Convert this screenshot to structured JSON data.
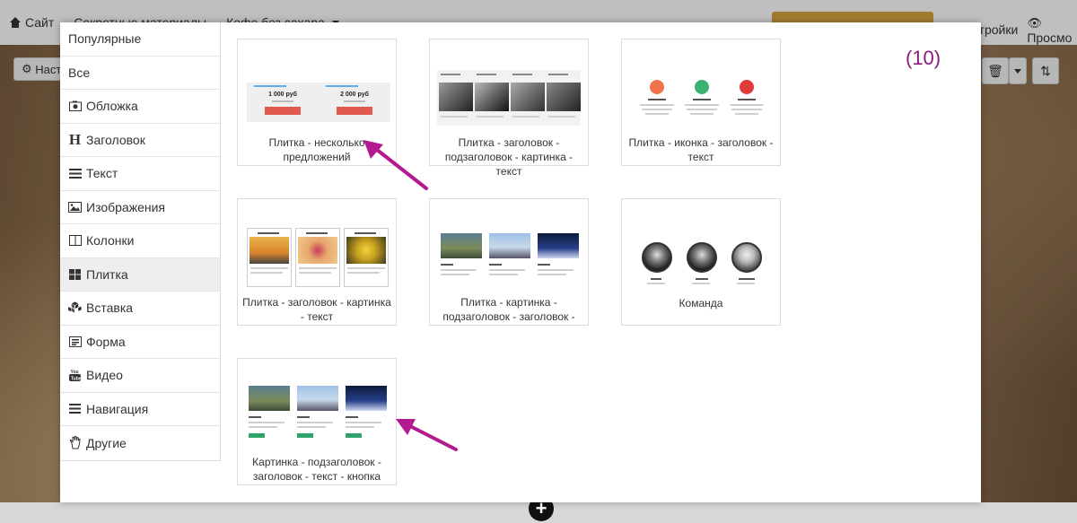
{
  "topbar": {
    "crumb_site": "Сайт",
    "crumb_section": "Секретные материалы",
    "crumb_page": "Кофе без сахара",
    "arrow_sep": "→",
    "settings_label": "Настройки",
    "preview_label": "Просмо"
  },
  "toolbar": {
    "settings_short": "Наст"
  },
  "modal": {
    "counter": "(10)",
    "sidebar": [
      {
        "label": "Популярные",
        "icon": ""
      },
      {
        "label": "Все",
        "icon": ""
      },
      {
        "label": "Обложка",
        "icon": "camera-icon"
      },
      {
        "label": "Заголовок",
        "icon": "heading-icon"
      },
      {
        "label": "Текст",
        "icon": "align-icon"
      },
      {
        "label": "Изображения",
        "icon": "image-icon"
      },
      {
        "label": "Колонки",
        "icon": "columns-icon"
      },
      {
        "label": "Плитка",
        "icon": "tiles-icon"
      },
      {
        "label": "Вставка",
        "icon": "cubes-icon"
      },
      {
        "label": "Форма",
        "icon": "form-icon"
      },
      {
        "label": "Видео",
        "icon": "youtube-icon"
      },
      {
        "label": "Навигация",
        "icon": "bars-icon"
      },
      {
        "label": "Другие",
        "icon": "hand-icon"
      }
    ],
    "active_sidebar_index": 7,
    "cards": [
      {
        "label": "Плитка - несколько предложений",
        "prices": [
          "1 000 руб",
          "2 000 руб"
        ]
      },
      {
        "label": "Плитка - заголовок - подзаголовок - картинка - текст"
      },
      {
        "label": "Плитка - иконка - заголовок - текст"
      },
      {
        "label": "Плитка - заголовок - картинка - текст"
      },
      {
        "label": "Плитка - картинка - подзаголовок - заголовок -"
      },
      {
        "label": "Команда"
      },
      {
        "label": "Картинка - подзаголовок - заголовок - текст - кнопка"
      }
    ]
  },
  "colors": {
    "accent_arrow": "#b5198f",
    "counter": "#8b1a7a",
    "price_button": "#e05a4d",
    "publish_button": "#d9a441"
  }
}
